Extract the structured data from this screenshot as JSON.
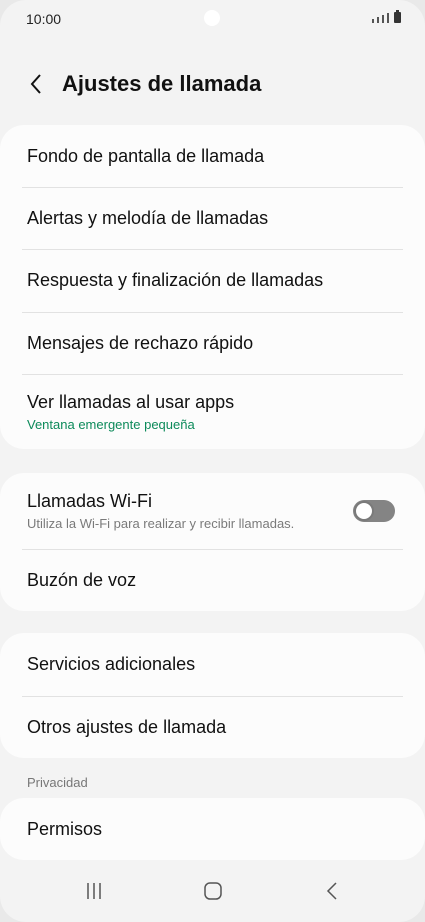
{
  "status_bar": {
    "time": "10:00"
  },
  "header": {
    "title": "Ajustes de llamada"
  },
  "group1": {
    "items": [
      {
        "label": "Fondo de pantalla de llamada"
      },
      {
        "label": "Alertas y melodía de llamadas"
      },
      {
        "label": "Respuesta y finalización de llamadas"
      },
      {
        "label": "Mensajes de rechazo rápido"
      },
      {
        "label": "Ver llamadas al usar apps",
        "subtitle": "Ventana emergente pequeña"
      }
    ]
  },
  "group2": {
    "wifi": {
      "label": "Llamadas Wi-Fi",
      "subtitle": "Utiliza la Wi-Fi para realizar y recibir llamadas.",
      "enabled": false
    },
    "voicemail": {
      "label": "Buzón de voz"
    }
  },
  "group3": {
    "items": [
      {
        "label": "Servicios adicionales"
      },
      {
        "label": "Otros ajustes de llamada"
      }
    ]
  },
  "privacy": {
    "section_label": "Privacidad",
    "items": [
      {
        "label": "Permisos"
      }
    ]
  },
  "icons": {
    "back": "chevron-left-icon",
    "recents": "recents-icon",
    "home": "home-icon",
    "nav_back": "nav-back-icon"
  },
  "colors": {
    "subtitle_green": "#0c8a5a",
    "toggle_off": "#848484"
  }
}
